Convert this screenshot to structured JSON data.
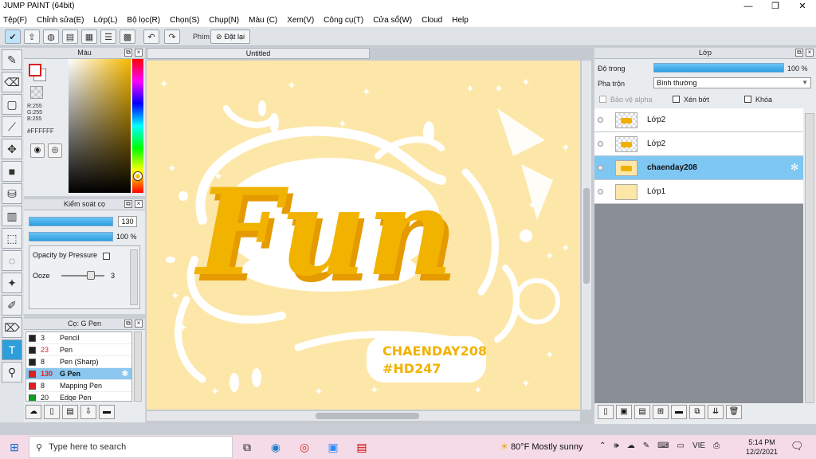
{
  "app": {
    "title": "JUMP PAINT (64bit)"
  },
  "window_controls": {
    "minimize": "—",
    "maximize": "❐",
    "close": "✕"
  },
  "menu": [
    "Tệp(F)",
    "Chỉnh sửa(E)",
    "Lớp(L)",
    "Bộ lọc(R)",
    "Chọn(S)",
    "Chụp(N)",
    "Màu (C)",
    "Xem(V)",
    "Công cụ(T)",
    "Cửa sổ(W)",
    "Cloud",
    "Help"
  ],
  "toolbar": {
    "key_label": "Phím",
    "reset_label": "Đặt lại"
  },
  "color_panel": {
    "title": "Màu",
    "r": "R:255",
    "g": "G:255",
    "b": "B:255",
    "hex": "#FFFFFF"
  },
  "brush_panel": {
    "title": "Kiểm soát cọ",
    "size_value": "130",
    "opacity_value": "100 %",
    "opacity_by_pressure": "Opacity by Pressure",
    "ooze_label": "Ooze",
    "ooze_value": "3"
  },
  "pen_panel": {
    "title": "Cọ: G Pen",
    "items": [
      {
        "size": "3",
        "name": "Pencil",
        "color": "#222222"
      },
      {
        "size": "23",
        "name": "Pen",
        "color": "#222222"
      },
      {
        "size": "8",
        "name": "Pen (Sharp)",
        "color": "#222222"
      },
      {
        "size": "130",
        "name": "G Pen",
        "color": "#e02020"
      },
      {
        "size": "8",
        "name": "Mapping Pen",
        "color": "#e02020"
      },
      {
        "size": "20",
        "name": "Edge Pen",
        "color": "#10a020"
      }
    ]
  },
  "document": {
    "tab_title": "Untitled"
  },
  "canvas_art": {
    "main_text": "Fun",
    "tag_line1": "CHAENDAY208",
    "tag_line2": "#HD247"
  },
  "layer_panel": {
    "title": "Lớp",
    "opacity_label": "Độ trong",
    "opacity_value": "100 %",
    "blend_label": "Pha trộn",
    "blend_value": "Bình thường",
    "protect_alpha": "Bảo vệ alpha",
    "clipping": "Xén bớt",
    "lock": "Khóa",
    "layers": [
      "Lớp2",
      "Lớp2",
      "chaenday208",
      "Lớp1"
    ]
  },
  "taskbar": {
    "search_placeholder": "Type here to search",
    "weather": "80°F  Mostly sunny",
    "lang": "VIE",
    "time": "5:14 PM",
    "date": "12/2/2021"
  },
  "colors": {
    "accent": "#2c9ed9",
    "canvas": "#fde7a8",
    "letter": "#f2b200"
  }
}
